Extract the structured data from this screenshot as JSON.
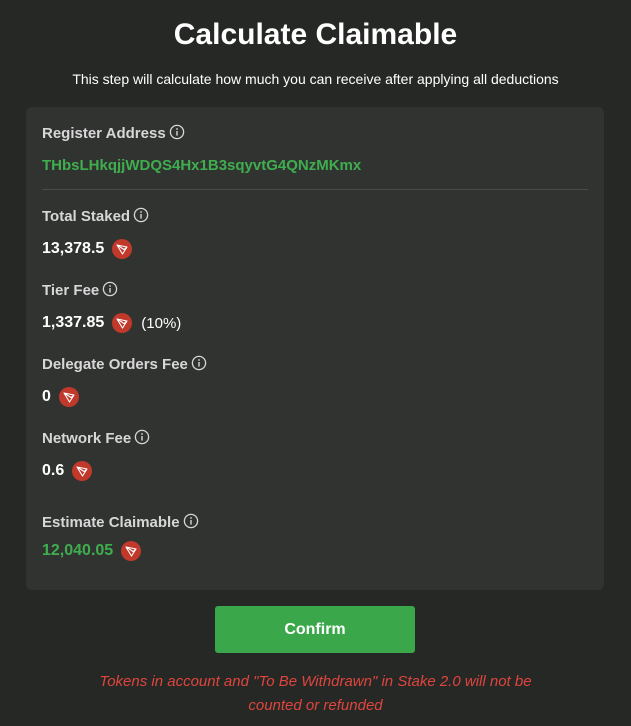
{
  "header": {
    "title": "Calculate Claimable",
    "subtitle": "This step will calculate how much you can receive after applying all deductions"
  },
  "card": {
    "register_address": {
      "label": "Register Address",
      "value": "THbsLHkqjjWDQS4Hx1B3sqyvtG4QNzMKmx"
    },
    "total_staked": {
      "label": "Total Staked",
      "value": "13,378.5"
    },
    "tier_fee": {
      "label": "Tier Fee",
      "value": "1,337.85",
      "percent": "(10%)"
    },
    "delegate_orders_fee": {
      "label": "Delegate Orders Fee",
      "value": "0"
    },
    "network_fee": {
      "label": "Network Fee",
      "value": "0.6"
    },
    "estimate_claimable": {
      "label": "Estimate Claimable",
      "value": "12,040.05"
    }
  },
  "actions": {
    "confirm_label": "Confirm"
  },
  "warning": {
    "line1": "Tokens in account and \"To Be Withdrawn\" in Stake 2.0 will not be",
    "line2": "counted or refunded"
  },
  "icons": {
    "info": "info-circle-icon",
    "token": "trx-token-icon"
  },
  "colors": {
    "background": "#262826",
    "card": "#313331",
    "accent_green": "#3fae4f",
    "button_green": "#3aa84a",
    "warning_red": "#e0453d",
    "token_red": "#c0392b"
  }
}
